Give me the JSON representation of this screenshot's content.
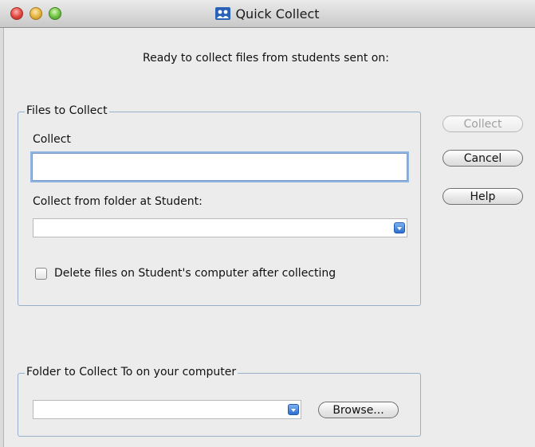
{
  "window": {
    "title": "Quick Collect"
  },
  "status_text": "Ready to collect files from students sent on:",
  "files_group": {
    "legend": "Files to Collect",
    "collect_label": "Collect",
    "collect_value": "",
    "folder_label": "Collect from folder at Student:",
    "folder_value": "",
    "delete_checkbox_label": "Delete files on Student's computer after collecting",
    "delete_checked": false
  },
  "dest_group": {
    "legend": "Folder to Collect To on your computer",
    "folder_value": "",
    "browse_label": "Browse..."
  },
  "buttons": {
    "collect": "Collect",
    "cancel": "Cancel",
    "help": "Help"
  },
  "icons": {
    "window_controls": [
      "close-icon",
      "minimize-icon",
      "zoom-icon"
    ],
    "app": "app-icon",
    "dropdown": "chevron-down-icon"
  },
  "colors": {
    "accent": "#2d6fd0",
    "focus_ring": "#8fb6e3",
    "disabled_text": "#a0a0a0"
  }
}
